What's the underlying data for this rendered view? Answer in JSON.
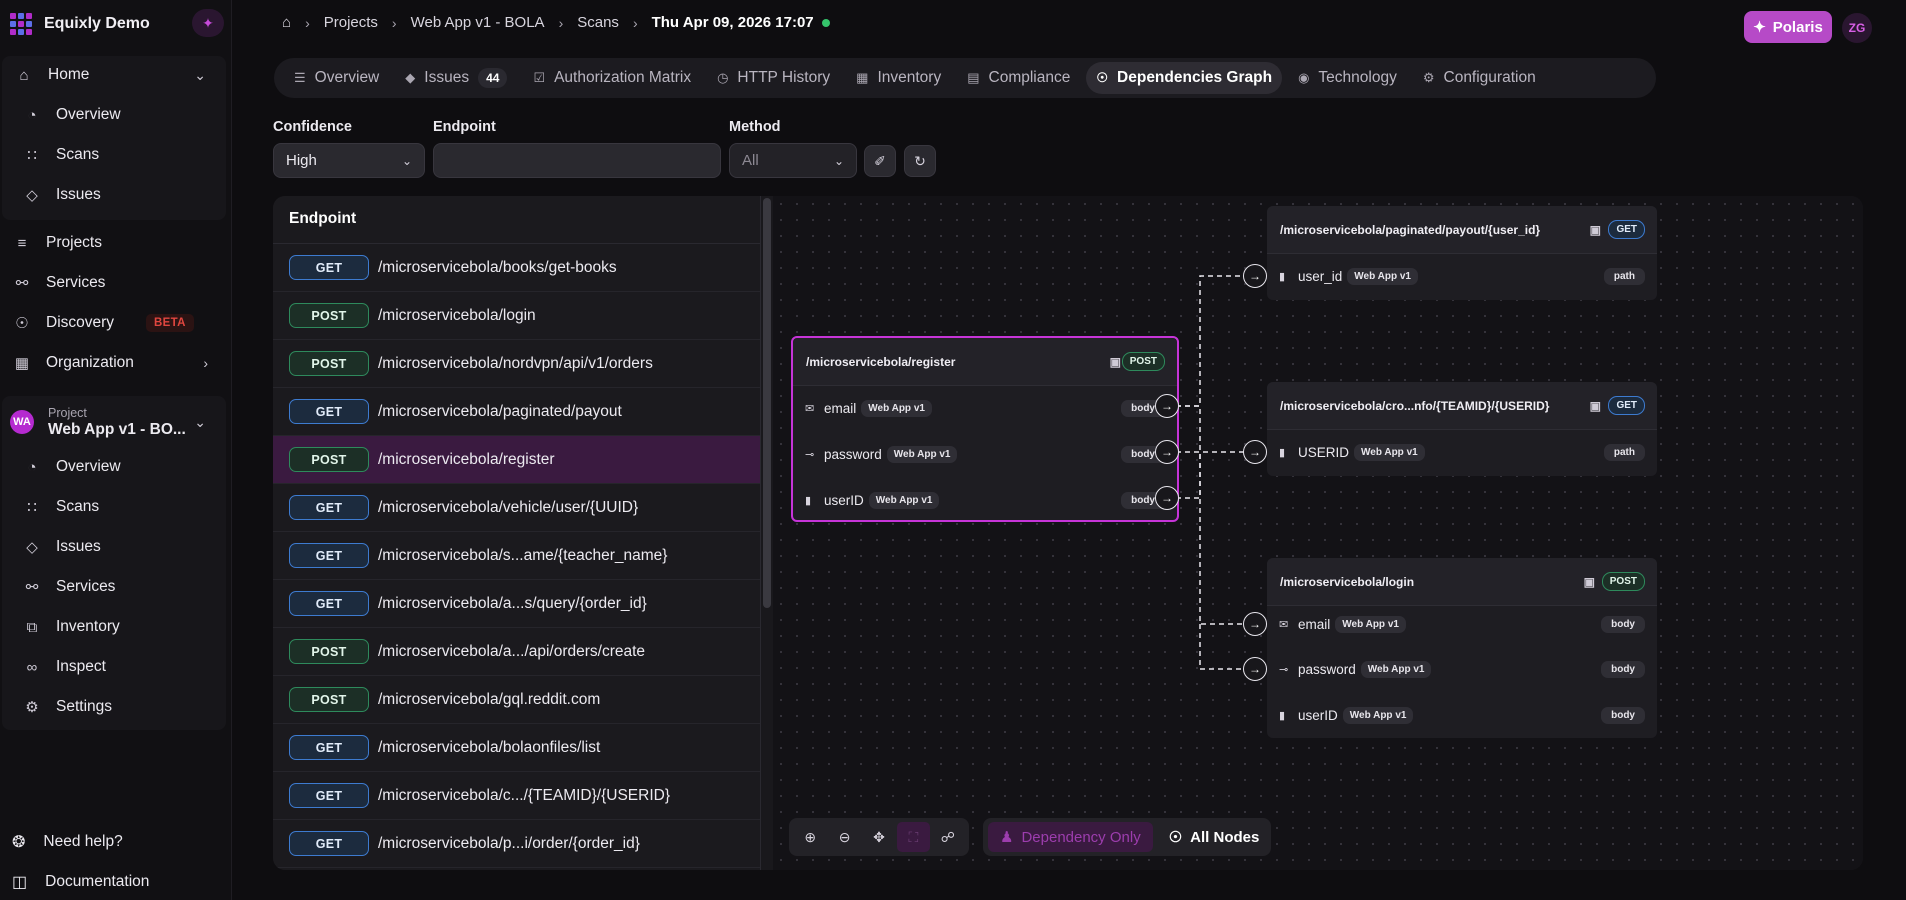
{
  "app": {
    "name": "Equixly Demo"
  },
  "sidebar": {
    "home": {
      "label": "Home",
      "items": [
        {
          "label": "Overview",
          "icon": "clock-icon"
        },
        {
          "label": "Scans",
          "icon": "scan-icon"
        },
        {
          "label": "Issues",
          "icon": "diamond-icon"
        }
      ]
    },
    "main_items": [
      {
        "label": "Projects",
        "icon": "layers-icon"
      },
      {
        "label": "Services",
        "icon": "services-icon"
      },
      {
        "label": "Discovery",
        "icon": "compass-icon",
        "badge": "BETA"
      },
      {
        "label": "Organization",
        "icon": "building-icon"
      }
    ],
    "project": {
      "caption": "Project",
      "name": "Web App v1 - BO...",
      "initials": "WA",
      "items": [
        {
          "label": "Overview",
          "icon": "clock-icon"
        },
        {
          "label": "Scans",
          "icon": "scan-icon"
        },
        {
          "label": "Issues",
          "icon": "diamond-icon"
        },
        {
          "label": "Services",
          "icon": "services-icon"
        },
        {
          "label": "Inventory",
          "icon": "inventory-icon"
        },
        {
          "label": "Inspect",
          "icon": "binoculars-icon"
        },
        {
          "label": "Settings",
          "icon": "gear-icon"
        }
      ]
    },
    "footer": [
      {
        "label": "Need help?",
        "icon": "lifebuoy-icon"
      },
      {
        "label": "Documentation",
        "icon": "book-icon"
      }
    ]
  },
  "breadcrumb": [
    "Projects",
    "Web App v1 - BOLA",
    "Scans",
    "Thu Apr 09, 2026 17:07"
  ],
  "header": {
    "polaris": "Polaris",
    "user_initials": "ZG"
  },
  "tabs": [
    {
      "label": "Overview"
    },
    {
      "label": "Issues",
      "count": "44"
    },
    {
      "label": "Authorization Matrix"
    },
    {
      "label": "HTTP History"
    },
    {
      "label": "Inventory"
    },
    {
      "label": "Compliance"
    },
    {
      "label": "Dependencies Graph",
      "active": true
    },
    {
      "label": "Technology"
    },
    {
      "label": "Configuration"
    }
  ],
  "filters": {
    "confidence": {
      "label": "Confidence",
      "value": "High"
    },
    "endpoint": {
      "label": "Endpoint",
      "value": ""
    },
    "method": {
      "label": "Method",
      "value": "All"
    }
  },
  "endpoint_list": {
    "header": "Endpoint",
    "rows": [
      {
        "method": "GET",
        "path": "/microservicebola/books/get-books"
      },
      {
        "method": "POST",
        "path": "/microservicebola/login"
      },
      {
        "method": "POST",
        "path": "/microservicebola/nordvpn/api/v1/orders"
      },
      {
        "method": "GET",
        "path": "/microservicebola/paginated/payout"
      },
      {
        "method": "POST",
        "path": "/microservicebola/register",
        "selected": true
      },
      {
        "method": "GET",
        "path": "/microservicebola/vehicle/user/{UUID}"
      },
      {
        "method": "GET",
        "path": "/microservicebola/s...ame/{teacher_name}"
      },
      {
        "method": "GET",
        "path": "/microservicebola/a...s/query/{order_id}"
      },
      {
        "method": "POST",
        "path": "/microservicebola/a.../api/orders/create"
      },
      {
        "method": "POST",
        "path": "/microservicebola/gql.reddit.com"
      },
      {
        "method": "GET",
        "path": "/microservicebola/bolaonfiles/list"
      },
      {
        "method": "GET",
        "path": "/microservicebola/c.../{TEAMID}/{USERID}"
      },
      {
        "method": "GET",
        "path": "/microservicebola/p...i/order/{order_id}"
      }
    ]
  },
  "graph": {
    "source": {
      "path": "/microservicebola/register",
      "method": "POST",
      "fields": [
        {
          "name": "email",
          "service": "Web App v1",
          "location": "body",
          "icon": "mail-icon"
        },
        {
          "name": "password",
          "service": "Web App v1",
          "location": "body",
          "icon": "key-icon"
        },
        {
          "name": "userID",
          "service": "Web App v1",
          "location": "body",
          "icon": "id-icon"
        }
      ]
    },
    "targets": [
      {
        "path": "/microservicebola/paginated/payout/{user_id}",
        "method": "GET",
        "fields": [
          {
            "name": "user_id",
            "service": "Web App v1",
            "location": "path",
            "icon": "id-icon"
          }
        ]
      },
      {
        "path": "/microservicebola/cro...nfo/{TEAMID}/{USERID}",
        "method": "GET",
        "fields": [
          {
            "name": "USERID",
            "service": "Web App v1",
            "location": "path",
            "icon": "id-icon"
          }
        ]
      },
      {
        "path": "/microservicebola/login",
        "method": "POST",
        "fields": [
          {
            "name": "email",
            "service": "Web App v1",
            "location": "body",
            "icon": "mail-icon"
          },
          {
            "name": "password",
            "service": "Web App v1",
            "location": "body",
            "icon": "key-icon"
          },
          {
            "name": "userID",
            "service": "Web App v1",
            "location": "body",
            "icon": "id-icon"
          }
        ]
      }
    ],
    "modes": {
      "dependency_only": "Dependency Only",
      "all_nodes": "All Nodes"
    }
  },
  "colors": {
    "accent": "#b52ad0",
    "get": "#3d7bd0",
    "post": "#2e8a5c",
    "status": "#35c46b"
  }
}
